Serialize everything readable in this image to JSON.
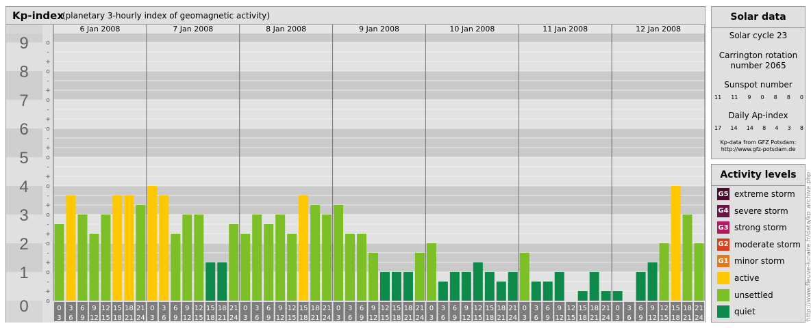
{
  "header": {
    "title": "Kp-index",
    "subtitle": "(planetary 3-hourly index of geomagnetic activity)"
  },
  "chart_data": {
    "type": "bar",
    "title": "Kp-index",
    "subtitle": "(planetary 3-hourly index of geomagnetic activity)",
    "days": [
      "6 Jan 2008",
      "7 Jan 2008",
      "8 Jan 2008",
      "9 Jan 2008",
      "10 Jan 2008",
      "11 Jan 2008",
      "12 Jan 2008"
    ],
    "interval_start_labels": [
      "0",
      "3",
      "6",
      "9",
      "12",
      "15",
      "18",
      "21"
    ],
    "interval_end_labels": [
      "3",
      "6",
      "9",
      "12",
      "15",
      "18",
      "21",
      "24"
    ],
    "y_major_ticks": [
      "0",
      "1",
      "2",
      "3",
      "4",
      "5",
      "6",
      "7",
      "8",
      "9"
    ],
    "y_minor_ticks": [
      "+",
      "o",
      "-"
    ],
    "ylim": [
      0,
      9.33
    ],
    "grid": true,
    "values": [
      [
        2.667,
        3.667,
        3.0,
        2.333,
        3.0,
        3.667,
        3.667,
        3.333
      ],
      [
        4.0,
        3.667,
        2.333,
        3.0,
        3.0,
        1.333,
        1.333,
        2.667
      ],
      [
        2.333,
        3.0,
        2.667,
        3.0,
        2.333,
        3.667,
        3.333,
        3.0
      ],
      [
        3.333,
        2.333,
        2.333,
        1.667,
        1.0,
        1.0,
        1.0,
        1.667
      ],
      [
        2.0,
        0.667,
        1.0,
        1.0,
        1.333,
        1.0,
        0.667,
        1.0
      ],
      [
        1.667,
        0.667,
        0.667,
        1.0,
        0.0,
        0.333,
        1.0,
        0.333
      ],
      [
        0.333,
        0.0,
        1.0,
        1.333,
        2.0,
        4.0,
        3.0,
        2.0
      ]
    ]
  },
  "solar": {
    "title": "Solar data",
    "cycle": "Solar cycle 23",
    "carrington_line1": "Carrington rotation",
    "carrington_line2": "number 2065",
    "sunspot_label": "Sunspot number",
    "sunspot_values": [
      "11",
      "11",
      "9",
      "0",
      "8",
      "8",
      "0"
    ],
    "ap_label": "Daily Ap-index",
    "ap_values": [
      "17",
      "14",
      "14",
      "8",
      "4",
      "3",
      "8"
    ],
    "source_line1": "Kp-data from GFZ Potsdam:",
    "source_line2": "http://www.gfz-potsdam.de"
  },
  "activity": {
    "title": "Activity levels",
    "levels": [
      {
        "code": "G5",
        "label": "extreme storm",
        "color": "#4a0a28"
      },
      {
        "code": "G4",
        "label": "severe storm",
        "color": "#6a1345"
      },
      {
        "code": "G3",
        "label": "strong storm",
        "color": "#b3195e"
      },
      {
        "code": "G2",
        "label": "moderate storm",
        "color": "#d6401c"
      },
      {
        "code": "G1",
        "label": "minor storm",
        "color": "#e6781c"
      },
      {
        "code": "",
        "label": "active",
        "color": "#ffc800"
      },
      {
        "code": "",
        "label": "unsettled",
        "color": "#7cbf26"
      },
      {
        "code": "",
        "label": "quiet",
        "color": "#0e8a4a"
      }
    ]
  },
  "colors": {
    "active": "#ffc800",
    "unsettled": "#7cbf26",
    "quiet": "#0e8a4a",
    "band_dark": "#cacaca",
    "band_light": "#e2e2e2",
    "footer_cell": "#7c7c7c"
  },
  "credit": "http://www.fleuve-lunaire.fr/data/kp_archive.php"
}
